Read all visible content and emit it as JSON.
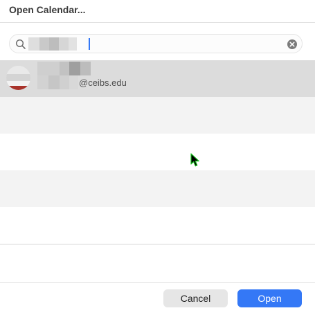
{
  "dialog": {
    "title": "Open Calendar..."
  },
  "search": {
    "value": "",
    "placeholder": "",
    "icon": "search-icon",
    "clear_icon": "clear-icon"
  },
  "results": {
    "rows": [
      {
        "email_suffix": "@ceibs.edu",
        "selected": true
      }
    ]
  },
  "footer": {
    "cancel_label": "Cancel",
    "open_label": "Open"
  },
  "colors": {
    "accent": "#3478f6",
    "selected_row": "#dcdcdc",
    "alt_row": "#f3f3f3"
  }
}
